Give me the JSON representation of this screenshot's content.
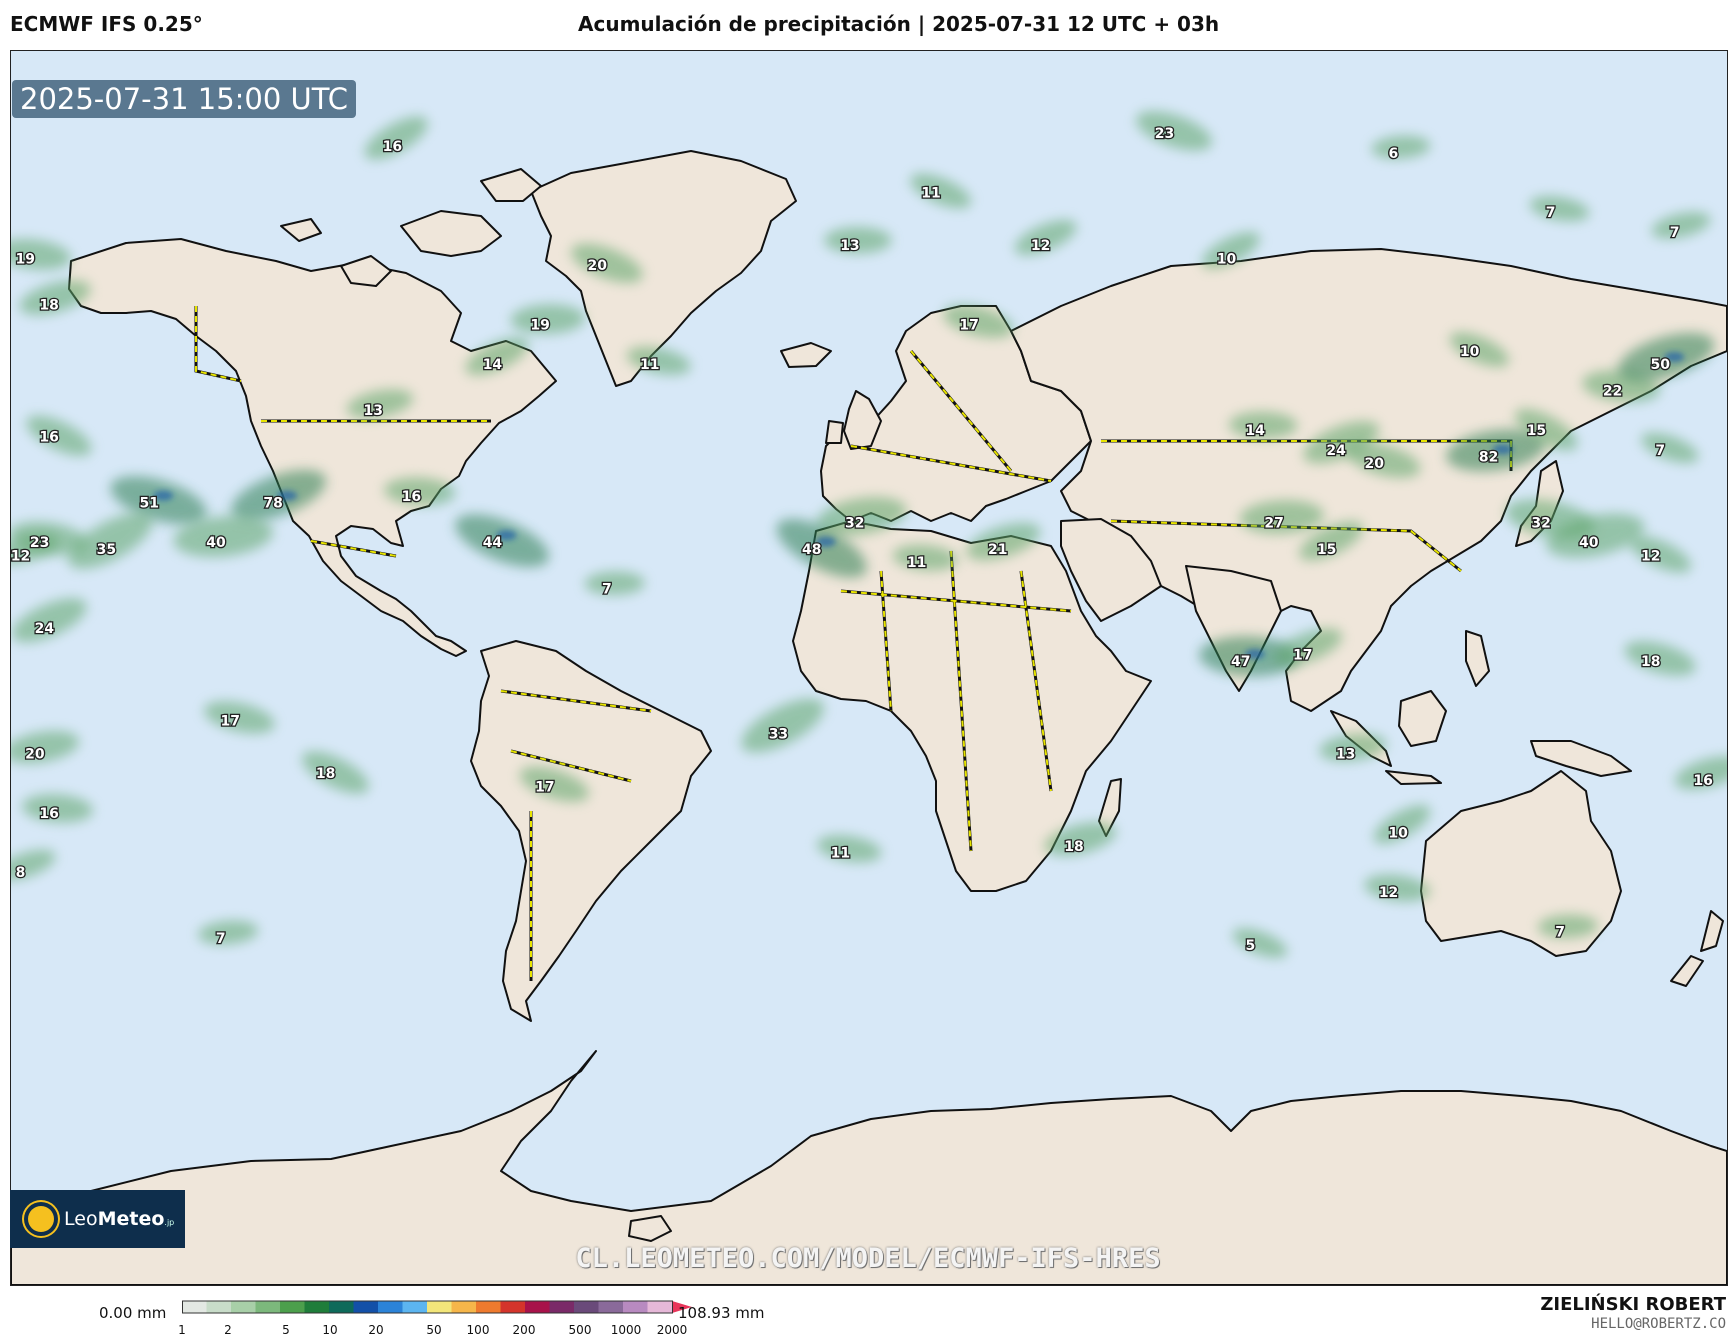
{
  "header": {
    "model_title": "ECMWF IFS 0.25°",
    "chart_title": "Acumulación de precipitación | 2025-07-31 12 UTC + 03h"
  },
  "map": {
    "valid_time": "2025-07-31 15:00 UTC",
    "ocean_color": "#d7e8f7",
    "land_color": "#efe6da",
    "border_color": "#e8e400",
    "precip_labels": [
      {
        "v": "16",
        "lon": -100,
        "lat": 68
      },
      {
        "v": "19",
        "lon": -177,
        "lat": 51
      },
      {
        "v": "18",
        "lon": -172,
        "lat": 44
      },
      {
        "v": "20",
        "lon": -57,
        "lat": 50
      },
      {
        "v": "19",
        "lon": -69,
        "lat": 41
      },
      {
        "v": "14",
        "lon": -79,
        "lat": 35
      },
      {
        "v": "11",
        "lon": -46,
        "lat": 35
      },
      {
        "v": "13",
        "lon": -104,
        "lat": 28
      },
      {
        "v": "16",
        "lon": -172,
        "lat": 24
      },
      {
        "v": "16",
        "lon": -96,
        "lat": 15
      },
      {
        "v": "78",
        "lon": -125,
        "lat": 14
      },
      {
        "v": "51",
        "lon": -151,
        "lat": 14
      },
      {
        "v": "40",
        "lon": -137,
        "lat": 8
      },
      {
        "v": "35",
        "lon": -160,
        "lat": 7
      },
      {
        "v": "23",
        "lon": -174,
        "lat": 8
      },
      {
        "v": "12",
        "lon": -178,
        "lat": 6
      },
      {
        "v": "44",
        "lon": -79,
        "lat": 8
      },
      {
        "v": "7",
        "lon": -55,
        "lat": 1
      },
      {
        "v": "24",
        "lon": -173,
        "lat": -5
      },
      {
        "v": "17",
        "lon": -134,
        "lat": -19
      },
      {
        "v": "20",
        "lon": -175,
        "lat": -24
      },
      {
        "v": "18",
        "lon": -114,
        "lat": -27
      },
      {
        "v": "16",
        "lon": -172,
        "lat": -33
      },
      {
        "v": "8",
        "lon": -178,
        "lat": -42
      },
      {
        "v": "17",
        "lon": -68,
        "lat": -29
      },
      {
        "v": "7",
        "lon": -136,
        "lat": -52
      },
      {
        "v": "33",
        "lon": -19,
        "lat": -21
      },
      {
        "v": "11",
        "lon": -6,
        "lat": -39
      },
      {
        "v": "18",
        "lon": 43,
        "lat": -38
      },
      {
        "v": "11",
        "lon": 13,
        "lat": 61
      },
      {
        "v": "13",
        "lon": -4,
        "lat": 53
      },
      {
        "v": "12",
        "lon": 36,
        "lat": 53
      },
      {
        "v": "17",
        "lon": 21,
        "lat": 41
      },
      {
        "v": "32",
        "lon": -3,
        "lat": 11
      },
      {
        "v": "48",
        "lon": -12,
        "lat": 7
      },
      {
        "v": "11",
        "lon": 10,
        "lat": 5
      },
      {
        "v": "21",
        "lon": 27,
        "lat": 7
      },
      {
        "v": "23",
        "lon": 62,
        "lat": 70
      },
      {
        "v": "6",
        "lon": 110,
        "lat": 67
      },
      {
        "v": "10",
        "lon": 75,
        "lat": 51
      },
      {
        "v": "7",
        "lon": 143,
        "lat": 58
      },
      {
        "v": "7",
        "lon": 169,
        "lat": 55
      },
      {
        "v": "10",
        "lon": 126,
        "lat": 37
      },
      {
        "v": "14",
        "lon": 81,
        "lat": 25
      },
      {
        "v": "24",
        "lon": 98,
        "lat": 22
      },
      {
        "v": "20",
        "lon": 106,
        "lat": 20
      },
      {
        "v": "82",
        "lon": 130,
        "lat": 21
      },
      {
        "v": "15",
        "lon": 140,
        "lat": 25
      },
      {
        "v": "22",
        "lon": 156,
        "lat": 31
      },
      {
        "v": "50",
        "lon": 166,
        "lat": 35
      },
      {
        "v": "7",
        "lon": 166,
        "lat": 22
      },
      {
        "v": "27",
        "lon": 85,
        "lat": 11
      },
      {
        "v": "15",
        "lon": 96,
        "lat": 7
      },
      {
        "v": "32",
        "lon": 141,
        "lat": 11
      },
      {
        "v": "40",
        "lon": 151,
        "lat": 8
      },
      {
        "v": "12",
        "lon": 164,
        "lat": 6
      },
      {
        "v": "47",
        "lon": 78,
        "lat": -10
      },
      {
        "v": "17",
        "lon": 91,
        "lat": -9
      },
      {
        "v": "18",
        "lon": 164,
        "lat": -10
      },
      {
        "v": "13",
        "lon": 100,
        "lat": -24
      },
      {
        "v": "10",
        "lon": 111,
        "lat": -36
      },
      {
        "v": "12",
        "lon": 109,
        "lat": -45
      },
      {
        "v": "16",
        "lon": 175,
        "lat": -28
      },
      {
        "v": "5",
        "lon": 80,
        "lat": -53
      },
      {
        "v": "7",
        "lon": 145,
        "lat": -51
      }
    ]
  },
  "watermark": {
    "logo_text_1": "Leo",
    "logo_text_2": "Meteo",
    "logo_sub": ".jp",
    "url": "CL.LEOMETEO.COM/MODEL/ECMWF-IFS-HRES"
  },
  "colorbar": {
    "min_label": "0.00 mm",
    "max_label": "108.93 mm",
    "ticks": [
      "1",
      "2",
      "5",
      "10",
      "20",
      "50",
      "100",
      "200",
      "500",
      "1000",
      "2000"
    ],
    "colors": [
      "#e3e8e3",
      "#c8dcc9",
      "#a8cfa8",
      "#7cb87c",
      "#4c9f4c",
      "#1f7d3a",
      "#0e6a5a",
      "#1350a8",
      "#2b83d8",
      "#5cb5f0",
      "#f3e67a",
      "#f6b64a",
      "#ee7a2e",
      "#d4342b",
      "#a8124a",
      "#7a2a68",
      "#6a4a7a",
      "#8a6a9a",
      "#b88ac0",
      "#e6b8d8"
    ]
  },
  "footer": {
    "author": "ZIELIŃSKI ROBERT",
    "email": "HELLO@ROBERTZ.CO"
  }
}
